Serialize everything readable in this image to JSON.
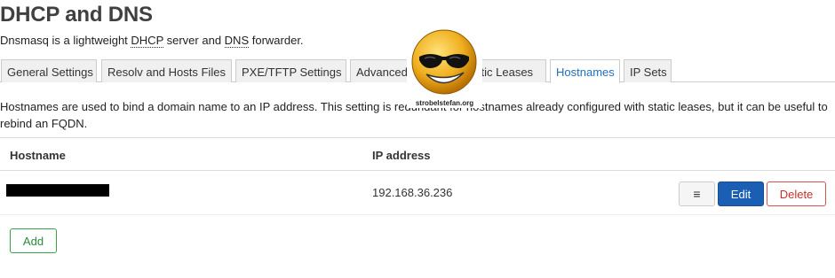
{
  "header": {
    "title": "DHCP and DNS",
    "description_prefix": "Dnsmasq is a lightweight ",
    "abbr_dhcp": "DHCP",
    "description_middle": " server and ",
    "abbr_dns": "DNS",
    "description_suffix": " forwarder."
  },
  "tabs": [
    {
      "label": "General Settings",
      "active": false
    },
    {
      "label": "Resolv and Hosts Files",
      "active": false
    },
    {
      "label": "PXE/TFTP Settings",
      "active": false
    },
    {
      "label": "Advanced Settings",
      "active": false
    },
    {
      "label": "Static Leases",
      "active": false
    },
    {
      "label": "Hostnames",
      "active": true
    },
    {
      "label": "IP Sets",
      "active": false
    }
  ],
  "section": {
    "description": "Hostnames are used to bind a domain name to an IP address. This setting is redundant for hostnames already configured with static leases, but it can be useful to rebind an FQDN."
  },
  "table": {
    "columns": [
      "Hostname",
      "IP address"
    ],
    "rows": [
      {
        "hostname": "[redacted]",
        "ip": "192.168.36.236"
      }
    ],
    "row_actions": {
      "menu_glyph": "≡",
      "edit": "Edit",
      "delete": "Delete"
    }
  },
  "actions": {
    "add": "Add"
  },
  "watermark": {
    "text": "strobelstefan.org",
    "icon": "sunglasses-smiley-icon"
  },
  "colors": {
    "accent": "#1a5fb4",
    "danger": "#d9534f",
    "success": "#3aa14a",
    "active_tab": "#1f6fbf"
  }
}
